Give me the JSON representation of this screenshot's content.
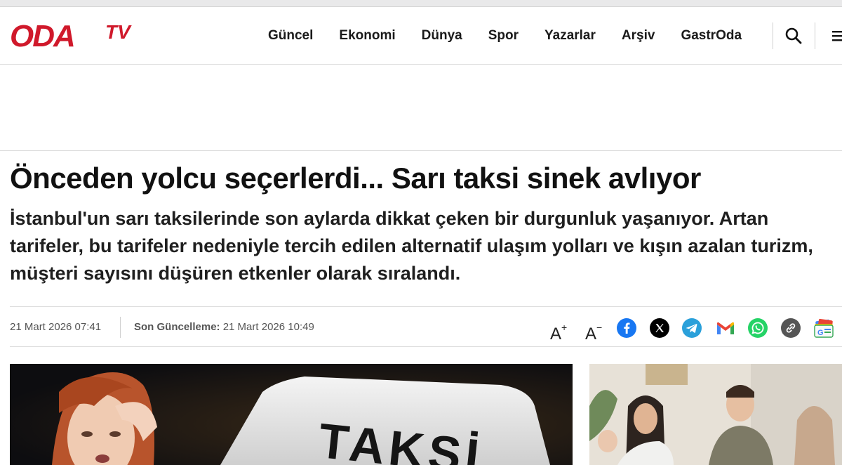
{
  "site": {
    "logo_main": "ODA",
    "logo_sub": "TV",
    "brand_color": "#d0192b"
  },
  "nav": {
    "items": [
      "Güncel",
      "Ekonomi",
      "Dünya",
      "Spor",
      "Yazarlar",
      "Arşiv",
      "GastrOda"
    ],
    "icons": [
      "search-icon",
      "menu-icon"
    ]
  },
  "article": {
    "headline": "Önceden yolcu seçerlerdi... Sarı taksi sinek avlıyor",
    "summary": "İstanbul'un sarı taksilerinde son aylarda dikkat çeken bir durgunluk yaşanıyor. Artan tarifeler, bu tarifeler nedeniyle tercih edilen alternatif ulaşım yolları ve kışın azalan turizm, müşteri sayısını düşüren etkenler olarak sıralandı.",
    "published": "21 Mart 2026 07:41",
    "updated_label": "Son Güncelleme:",
    "updated_value": "21 Mart 2026 10:49"
  },
  "tools": {
    "font_increase": "A",
    "font_increase_sup": "+",
    "font_decrease": "A",
    "font_decrease_sup": "−",
    "share_icons": [
      "facebook-icon",
      "x-icon",
      "telegram-icon",
      "gmail-icon",
      "whatsapp-icon",
      "link-icon",
      "google-news-icon"
    ]
  },
  "images": {
    "hero_sign_text": "TAKSİ"
  },
  "colors": {
    "facebook": "#1877f2",
    "x": "#000000",
    "telegram": "#2aa0da",
    "whatsapp": "#25d366",
    "link": "#555555"
  }
}
